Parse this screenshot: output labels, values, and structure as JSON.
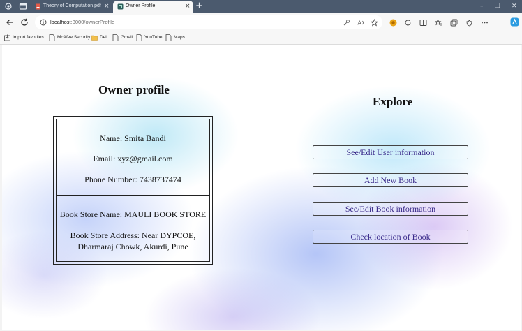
{
  "browser": {
    "tabs": [
      {
        "title": "Theory of Computation.pdf",
        "active": false
      },
      {
        "title": "Owner Profile",
        "active": true
      }
    ],
    "new_tab_label": "+",
    "close_glyph": "×",
    "window_controls": {
      "minimize": "–",
      "restore": "❐",
      "close": "✕"
    },
    "address": {
      "host": "localhost",
      "path": ":3000/ownerProfile"
    },
    "bookmarks": [
      {
        "label": "Import favorites",
        "icon": "import-icon"
      },
      {
        "label": "McAfee Security",
        "icon": "page-icon"
      },
      {
        "label": "Dell",
        "icon": "folder-icon"
      },
      {
        "label": "Gmail",
        "icon": "page-icon"
      },
      {
        "label": "YouTube",
        "icon": "page-icon"
      },
      {
        "label": "Maps",
        "icon": "page-icon"
      }
    ]
  },
  "page": {
    "owner_heading": "Owner profile",
    "explore_heading": "Explore",
    "owner": {
      "name": "Name: Smita Bandi",
      "email": "Email: xyz@gmail.com",
      "phone": "Phone Number: 7438737474",
      "store_name": "Book Store Name: MAULI BOOK STORE",
      "store_address_line1": "Book Store Address: Near DYPCOE,",
      "store_address_line2": "Dharmaraj Chowk, Akurdi, Pune"
    },
    "explore_buttons": [
      {
        "label": "See/Edit User information"
      },
      {
        "label": "Add New Book"
      },
      {
        "label": "See/Edit Book information"
      },
      {
        "label": "Check location of Book"
      }
    ]
  },
  "colors": {
    "tab_strip": "#4b5a6e",
    "toolbar": "#f7f7f7",
    "button_text": "#3a2a8a"
  }
}
